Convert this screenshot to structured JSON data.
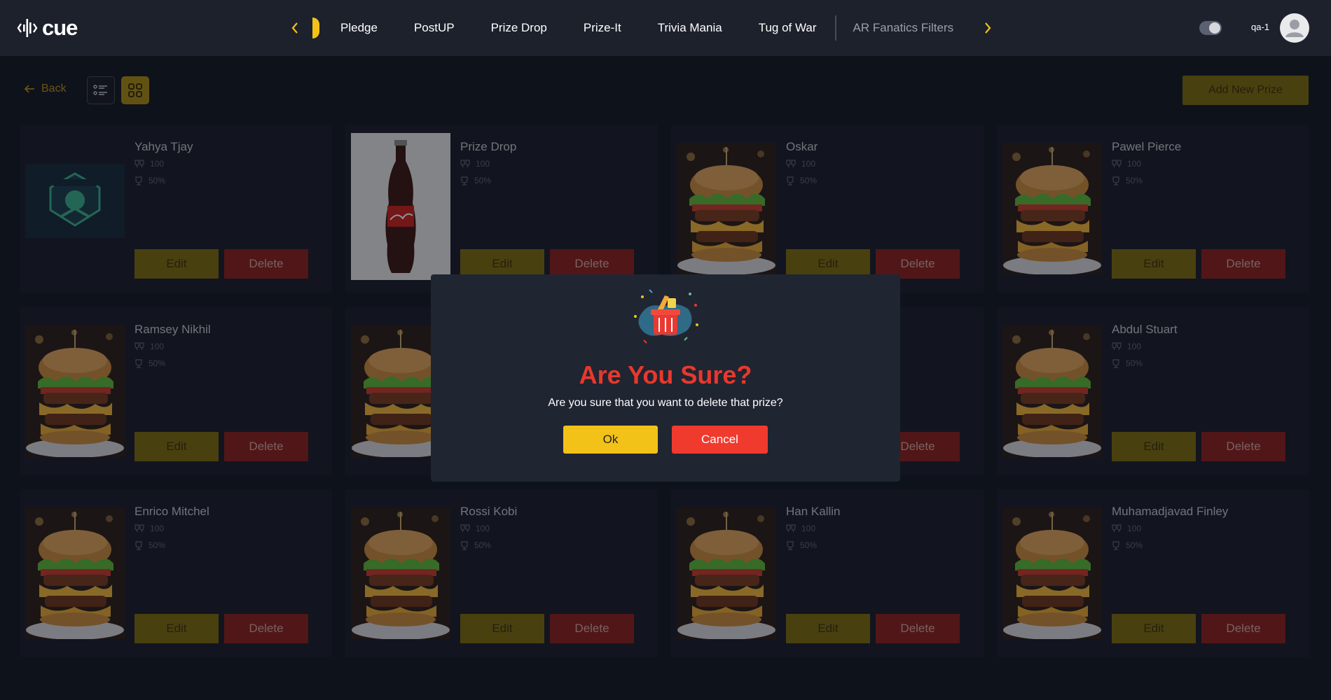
{
  "app": {
    "logo_text": "cue",
    "user_name": "qa-1"
  },
  "nav": {
    "items": [
      "Pledge",
      "PostUP",
      "Prize Drop",
      "Prize-It",
      "Trivia Mania",
      "Tug of War"
    ],
    "dim_item": "AR Fanatics Filters"
  },
  "toolbar": {
    "back_label": "Back",
    "add_label": "Add New Prize"
  },
  "card_labels": {
    "edit": "Edit",
    "delete": "Delete"
  },
  "prizes": [
    {
      "title": "Yahya Tjay",
      "quantity": "100",
      "chance": "50%",
      "image": "dream-team-logo"
    },
    {
      "title": "Prize Drop",
      "quantity": "100",
      "chance": "50%",
      "image": "soda-bottle"
    },
    {
      "title": "Oskar",
      "quantity": "100",
      "chance": "50%",
      "image": "burger"
    },
    {
      "title": "Pawel Pierce",
      "quantity": "100",
      "chance": "50%",
      "image": "burger"
    },
    {
      "title": "Ramsey Nikhil",
      "quantity": "100",
      "chance": "50%",
      "image": "burger"
    },
    {
      "title": "",
      "quantity": "",
      "chance": "",
      "image": "burger"
    },
    {
      "title": "",
      "quantity": "",
      "chance": "",
      "image": ""
    },
    {
      "title": "Abdul Stuart",
      "quantity": "100",
      "chance": "50%",
      "image": "burger"
    },
    {
      "title": "Enrico Mitchel",
      "quantity": "100",
      "chance": "50%",
      "image": "burger"
    },
    {
      "title": "Rossi Kobi",
      "quantity": "100",
      "chance": "50%",
      "image": "burger"
    },
    {
      "title": "Han Kallin",
      "quantity": "100",
      "chance": "50%",
      "image": "burger"
    },
    {
      "title": "Muhamadjavad Finley",
      "quantity": "100",
      "chance": "50%",
      "image": "burger"
    }
  ],
  "modal": {
    "title": "Are You Sure?",
    "message": "Are you sure that you want to delete that prize?",
    "ok_label": "Ok",
    "cancel_label": "Cancel"
  },
  "colors": {
    "accent": "#f2c218",
    "danger": "#f03a2e",
    "background": "#121722",
    "card": "#181d28"
  }
}
